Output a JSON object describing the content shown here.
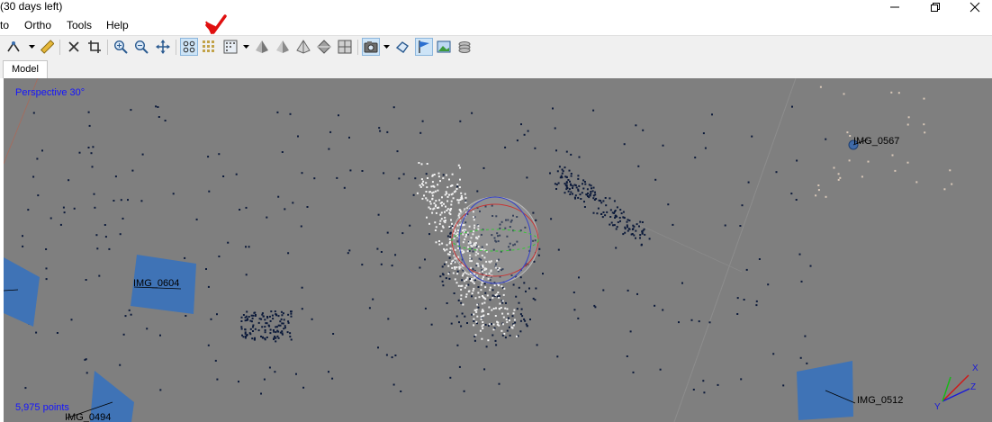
{
  "window": {
    "title": "(30 days left)",
    "controls": [
      "minimize",
      "restore",
      "close"
    ]
  },
  "menu": {
    "items": [
      "to",
      "Ortho",
      "Tools",
      "Help"
    ]
  },
  "toolbar": {
    "icons": [
      "navigation-icon",
      "ruler-icon",
      "delete-icon",
      "crop-icon",
      "zoom-in-icon",
      "zoom-out-icon",
      "move-icon",
      "point-cloud-icon",
      "dense-cloud-icon",
      "grid-icon",
      "model-shaded-icon",
      "model-solid-icon",
      "model-wireframe-icon",
      "model-textured-icon",
      "tiled-model-icon",
      "camera-icon",
      "show-shapes-icon",
      "flag-icon",
      "image-icon",
      "layers-icon"
    ]
  },
  "tabs": [
    {
      "label": "Model",
      "active": true
    }
  ],
  "viewport": {
    "projection_label": "Perspective 30°",
    "points_label": "5,975 points",
    "cameras": [
      {
        "label": "IMG_0604"
      },
      {
        "label": "IMG_0567"
      },
      {
        "label": "IMG_0512"
      },
      {
        "label": "IMG_0494"
      }
    ],
    "axes": {
      "x": "X",
      "y": "Y",
      "z": "Z"
    },
    "colors": {
      "background": "#7f7f7f",
      "camera_plane": "#3f73b6",
      "label_text": "#1414ff",
      "point_dark": "#0c1a3a",
      "point_light": "#f2f2f2"
    }
  }
}
